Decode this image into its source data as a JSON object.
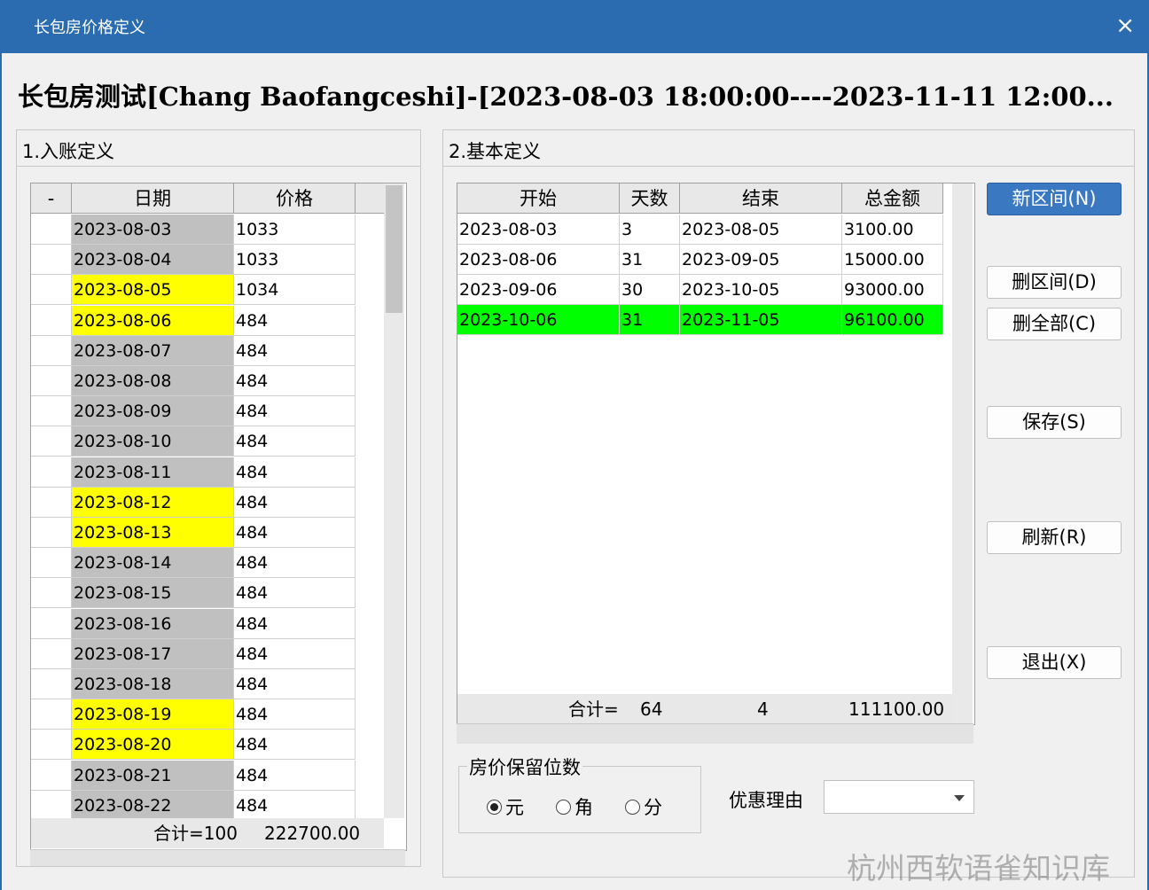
{
  "window": {
    "title": "长包房价格定义",
    "close_icon": "×"
  },
  "header": {
    "text": "长包房测试[Chang Baofangceshi]-[2023-08-03 18:00:00----2023-11-11 12:00..."
  },
  "left_panel": {
    "title": "1.入账定义",
    "columns": [
      "-",
      "日期",
      "价格"
    ],
    "rows": [
      {
        "date": "2023-08-03",
        "price": "1033",
        "highlight": false
      },
      {
        "date": "2023-08-04",
        "price": "1033",
        "highlight": false
      },
      {
        "date": "2023-08-05",
        "price": "1034",
        "highlight": true
      },
      {
        "date": "2023-08-06",
        "price": "484",
        "highlight": true
      },
      {
        "date": "2023-08-07",
        "price": "484",
        "highlight": false
      },
      {
        "date": "2023-08-08",
        "price": "484",
        "highlight": false
      },
      {
        "date": "2023-08-09",
        "price": "484",
        "highlight": false
      },
      {
        "date": "2023-08-10",
        "price": "484",
        "highlight": false
      },
      {
        "date": "2023-08-11",
        "price": "484",
        "highlight": false
      },
      {
        "date": "2023-08-12",
        "price": "484",
        "highlight": true
      },
      {
        "date": "2023-08-13",
        "price": "484",
        "highlight": true
      },
      {
        "date": "2023-08-14",
        "price": "484",
        "highlight": false
      },
      {
        "date": "2023-08-15",
        "price": "484",
        "highlight": false
      },
      {
        "date": "2023-08-16",
        "price": "484",
        "highlight": false
      },
      {
        "date": "2023-08-17",
        "price": "484",
        "highlight": false
      },
      {
        "date": "2023-08-18",
        "price": "484",
        "highlight": false
      },
      {
        "date": "2023-08-19",
        "price": "484",
        "highlight": true
      },
      {
        "date": "2023-08-20",
        "price": "484",
        "highlight": true
      },
      {
        "date": "2023-08-21",
        "price": "484",
        "highlight": false
      },
      {
        "date": "2023-08-22",
        "price": "484",
        "highlight": false
      }
    ],
    "footer": {
      "count_label": "合计=100",
      "total": "222700.00"
    }
  },
  "right_panel": {
    "title": "2.基本定义",
    "columns": [
      "开始",
      "天数",
      "结束",
      "总金额"
    ],
    "rows": [
      {
        "start": "2023-08-03",
        "days": "3",
        "end": "2023-08-05",
        "amount": "3100.00",
        "selected": false
      },
      {
        "start": "2023-08-06",
        "days": "31",
        "end": "2023-09-05",
        "amount": "15000.00",
        "selected": false
      },
      {
        "start": "2023-09-06",
        "days": "30",
        "end": "2023-10-05",
        "amount": "93000.00",
        "selected": false
      },
      {
        "start": "2023-10-06",
        "days": "31",
        "end": "2023-11-05",
        "amount": "96100.00",
        "selected": true
      }
    ],
    "footer": {
      "label": "合计=",
      "days": "64",
      "count": "4",
      "total": "111100.00"
    }
  },
  "buttons": {
    "new_interval": "新区间(N)",
    "delete_interval": "删区间(D)",
    "delete_all": "删全部(C)",
    "save": "保存(S)",
    "refresh": "刷新(R)",
    "exit": "退出(X)"
  },
  "precision": {
    "title": "房价保留位数",
    "options": [
      "元",
      "角",
      "分"
    ],
    "selected": "元"
  },
  "discount": {
    "label": "优惠理由",
    "value": ""
  },
  "watermark": "杭州西软语雀知识库",
  "colors": {
    "titlebar": "#2b6cb0",
    "date_gray": "#c0c0c0",
    "date_weekend": "#ffff00",
    "selected_row": "#00ff00",
    "primary_button": "#3a78c2"
  }
}
